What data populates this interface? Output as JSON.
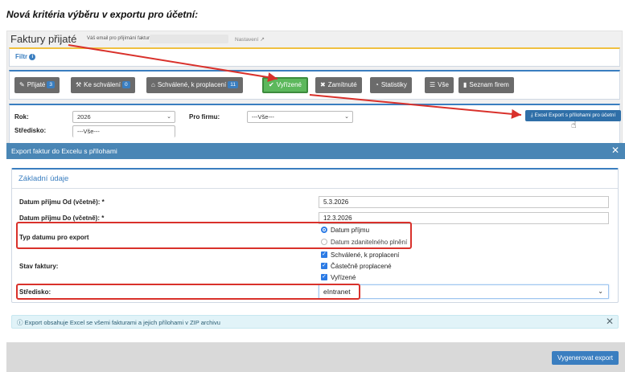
{
  "heading": "Nová kritéria výběru v exportu pro účetní:",
  "app": {
    "title": "Faktury přijaté",
    "email_label": "Váš email pro přijímání faktur :",
    "email_value": "",
    "settings_label": "Nastavení"
  },
  "filter_panel": {
    "label": "Filtr"
  },
  "tabs": [
    {
      "label": "Přijaté",
      "badge": "3",
      "icon": "edit-icon"
    },
    {
      "label": "Ke schválení",
      "badge": "0",
      "icon": "gavel-icon"
    },
    {
      "label": "Schválené, k proplacení",
      "badge": "11",
      "icon": "bank-icon"
    },
    {
      "label": "Vyřízené",
      "badge": "",
      "icon": "check-icon",
      "active": true
    },
    {
      "label": "Zamítnuté",
      "badge": "",
      "icon": "times-icon"
    },
    {
      "label": "Statistiky",
      "badge": "",
      "icon": "pie-chart-icon"
    },
    {
      "label": "Vše",
      "badge": "",
      "icon": "list-icon"
    },
    {
      "label": "Seznam firem",
      "badge": "",
      "icon": "book-icon"
    }
  ],
  "filters": {
    "rok_label": "Rok:",
    "rok_value": "2026",
    "firma_label": "Pro firmu:",
    "firma_value": "---Vše---",
    "stredisko_label": "Středisko:",
    "stredisko_value": "---Vše---",
    "export_button": "Excel Export s přílohami pro účetní"
  },
  "modal": {
    "title": "Export faktur do Excelu s přílohami",
    "section_title": "Základní údaje",
    "date_from_label": "Datum příjmu Od (včetně): *",
    "date_from_value": "5.3.2026",
    "date_to_label": "Datum příjmu Do (včetně): *",
    "date_to_value": "12.3.2026",
    "date_type_label": "Typ datumu pro export",
    "date_type_options": [
      {
        "label": "Datum příjmu",
        "checked": true
      },
      {
        "label": "Datum zdanitelného plnění",
        "checked": false
      }
    ],
    "status_label": "Stav faktury:",
    "status_options": [
      {
        "label": "Schválené, k proplacení",
        "checked": true
      },
      {
        "label": "Částečně proplacené",
        "checked": true
      },
      {
        "label": "Vyřízené",
        "checked": true
      }
    ],
    "stredisko_label": "Středisko:",
    "stredisko_value": "eIntranet",
    "info_text": "Export obsahuje Excel se všemi fakturami a jejich přílohami v ZIP archivu",
    "generate_button": "Vygenerovat export"
  },
  "colors": {
    "accent": "#3a7ec0",
    "active_tab": "#5cb85c",
    "annotation_red": "#d9312b",
    "modal_header": "#4a86b5"
  }
}
